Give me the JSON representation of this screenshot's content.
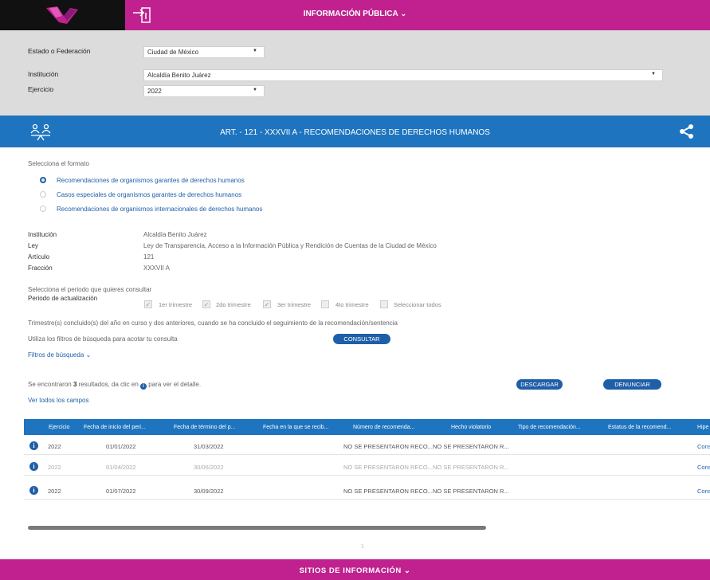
{
  "header": {
    "title": "INFORMACIÓN PÚBLICA",
    "title_chevron": "⌄",
    "logo_icon": "logo-icon",
    "login_icon": "login-icon",
    "colors": {
      "magenta": "#c0218f",
      "black": "#111111"
    }
  },
  "filters": {
    "estado_label": "Estado o Federación",
    "estado_value": "Ciudad de México",
    "institucion_label": "Institución",
    "institucion_value": "Alcaldía Benito Juárez",
    "ejercicio_label": "Ejercicio",
    "ejercicio_value": "2022"
  },
  "article": {
    "title": "ART. - 121 - XXXVII A - RECOMENDACIONES DE DERECHOS HUMANOS",
    "icon": "people-balance-icon",
    "share_icon": "share-icon",
    "color": "#1f74bf"
  },
  "format": {
    "label": "Selecciona el formato",
    "options": [
      {
        "label": "Recomendaciones de organismos garantes de derechos humanos",
        "selected": true
      },
      {
        "label": "Casos especiales de organismos garantes de derechos humanos",
        "selected": false
      },
      {
        "label": "Recomendaciones de organismos internacionales de derechos humanos",
        "selected": false
      }
    ]
  },
  "details": {
    "institucion_label": "Institución",
    "institucion_value": "Alcaldía Benito Juárez",
    "ley_label": "Ley",
    "ley_value": "Ley de Transparencia, Acceso a la Información Pública y Rendición de Cuentas de la Ciudad de México",
    "articulo_label": "Artículo",
    "articulo_value": "121",
    "fraccion_label": "Fracción",
    "fraccion_value": "XXXVII A"
  },
  "period": {
    "intro": "Selecciona el periodo que quieres consultar",
    "label": "Periodo de actualización",
    "options": [
      {
        "label": "1er trimestre",
        "checked": true
      },
      {
        "label": "2do trimestre",
        "checked": true
      },
      {
        "label": "3er trimestre",
        "checked": true
      },
      {
        "label": "4to trimestre",
        "checked": false
      },
      {
        "label": "Seleccionar todos",
        "checked": false
      }
    ],
    "note": "Trimestre(s) concluido(s) del año en curso y dos anteriores, cuando se ha concluido el seguimiento de la recomendación/sentencia"
  },
  "search": {
    "hint": "Utiliza los filtros de búsqueda para acotar tu consulta",
    "consultar": "CONSULTAR",
    "filtros_link": "Filtros de búsqueda",
    "filtros_chevron": "⌄"
  },
  "results": {
    "prefix": "Se encontraron",
    "count": "3",
    "middle": "resultados, da clic en",
    "suffix": "para ver el detalle.",
    "descargar": "DESCARGAR",
    "denunciar": "DENUNCIAR",
    "ver_todos": "Ver todos los campos"
  },
  "table": {
    "columns": [
      "Ejercicio",
      "Fecha de inicio del peri...",
      "Fecha de término del p...",
      "Fecha en la que se recib...",
      "Número de recomenda...",
      "Hecho violatorio",
      "Tipo de recomendación...",
      "Estatus de la recomend...",
      "Hipe"
    ],
    "rows": [
      {
        "ejercicio": "2022",
        "inicio": "01/01/2022",
        "termino": "31/03/2022",
        "numero": "NO SE PRESENTARON RECO...",
        "hecho": "NO SE PRESENTARON R...",
        "hiper": "Cons"
      },
      {
        "ejercicio": "2022",
        "inicio": "01/04/2022",
        "termino": "30/06/2022",
        "numero": "NO SE PRESENTARON RECO...",
        "hecho": "NO SE PRESENTARON R...",
        "hiper": "Cons"
      },
      {
        "ejercicio": "2022",
        "inicio": "01/07/2022",
        "termino": "30/09/2022",
        "numero": "NO SE PRESENTARON RECO...",
        "hecho": "NO SE PRESENTARON R...",
        "hiper": "Cons"
      }
    ]
  },
  "pagination": {
    "page": "1"
  },
  "footer": {
    "title": "SITIOS DE INFORMACIÓN",
    "chevron": "⌄"
  }
}
